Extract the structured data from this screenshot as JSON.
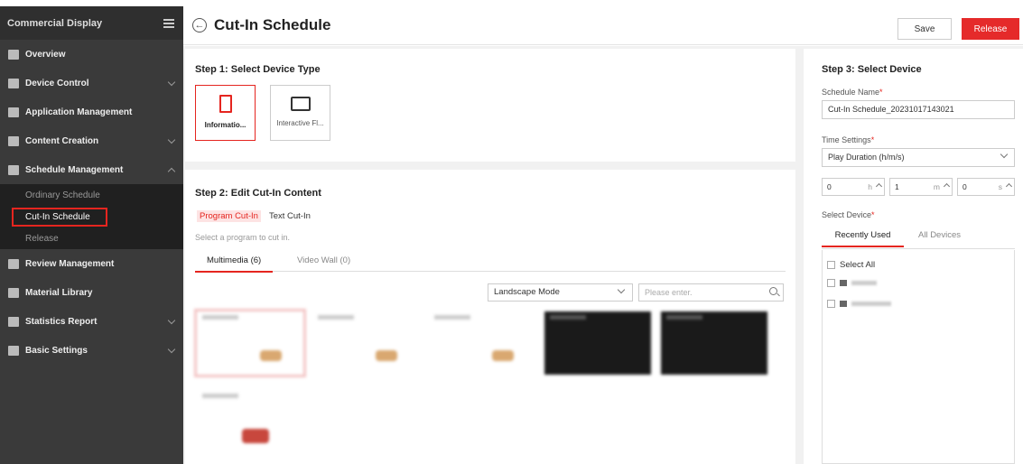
{
  "sidebar": {
    "title": "Commercial Display",
    "items": [
      {
        "label": "Overview",
        "icon": "monitor-icon"
      },
      {
        "label": "Device Control",
        "icon": "device-icon"
      },
      {
        "label": "Application Management",
        "icon": "app-icon"
      },
      {
        "label": "Content Creation",
        "icon": "content-icon"
      },
      {
        "label": "Schedule Management",
        "icon": "calendar-icon"
      },
      {
        "label": "Review Management",
        "icon": "review-icon"
      },
      {
        "label": "Material Library",
        "icon": "library-icon"
      },
      {
        "label": "Statistics Report",
        "icon": "report-icon"
      },
      {
        "label": "Basic Settings",
        "icon": "settings-icon"
      }
    ],
    "schedule_sub": [
      "Ordinary Schedule",
      "Cut-In Schedule",
      "Release"
    ]
  },
  "header": {
    "title": "Cut-In Schedule",
    "save_label": "Save",
    "release_label": "Release"
  },
  "step1": {
    "title": "Step 1: Select Device Type",
    "devices": [
      "Informatio...",
      "Interactive Fl..."
    ]
  },
  "step2": {
    "title": "Step 2: Edit Cut-In Content",
    "subtabs": [
      "Program Cut-In",
      "Text Cut-In"
    ],
    "hint": "Select a program to cut in.",
    "tabs": [
      "Multimedia (6)",
      "Video Wall (0)"
    ],
    "mode": "Landscape Mode",
    "search_placeholder": "Please enter."
  },
  "step3": {
    "title": "Step 3: Select Device",
    "schedule_name_label": "Schedule Name",
    "schedule_name_value": "Cut-In Schedule_20231017143021",
    "time_settings_label": "Time Settings",
    "time_settings_value": "Play Duration (h/m/s)",
    "hours": "0",
    "minutes": "1",
    "seconds": "0",
    "h_unit": "h",
    "m_unit": "m",
    "s_unit": "s",
    "select_device_label": "Select Device",
    "tabs": [
      "Recently Used",
      "All Devices"
    ],
    "select_all": "Select All",
    "required_mark": "*"
  },
  "colors": {
    "accent": "#e5251f",
    "sidebar": "#3a3a3a"
  }
}
